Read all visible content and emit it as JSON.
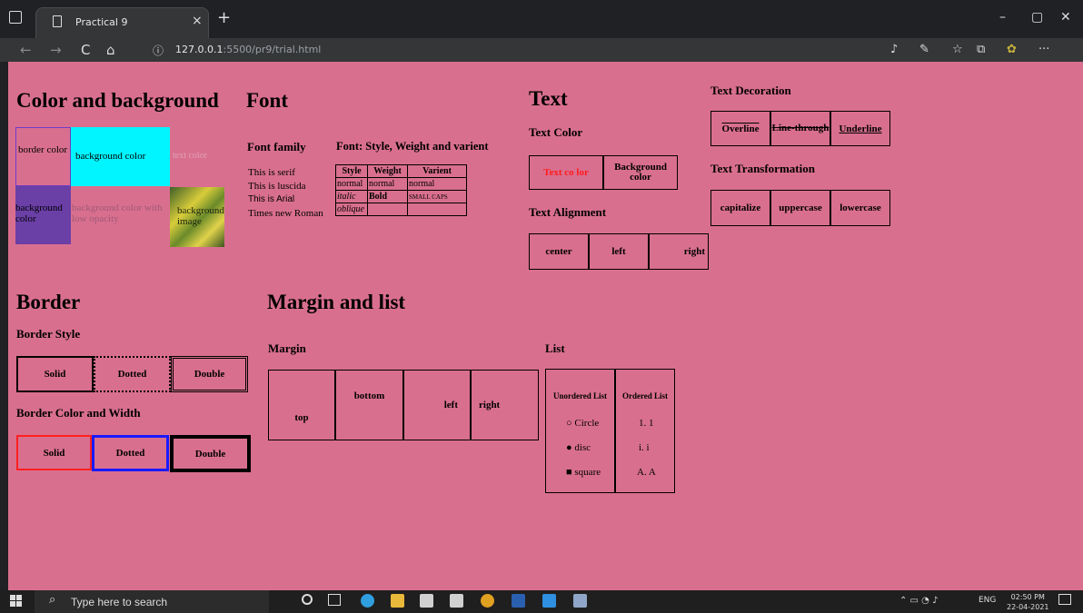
{
  "browser": {
    "tab_title": "Practical 9",
    "tab_close": "×",
    "new_tab": "+",
    "url_host": "127.0.0.1",
    "url_rest": ":5500/pr9/trial.html",
    "info": "ⓘ"
  },
  "window": {
    "minimize": "–",
    "maximize": "▢",
    "close": "✕"
  },
  "nav": {
    "back": "←",
    "forward": "→",
    "reload": "C",
    "home": "⌂"
  },
  "toolbar": {
    "more": "···"
  },
  "page": {
    "color_bg": {
      "title": "Color and background",
      "border_color": "border color",
      "background_color": "background color",
      "text_color": "text color",
      "bg_purple": "background color",
      "low_opacity": "background color with low opacity",
      "bg_image": "background image"
    },
    "font": {
      "title": "Font",
      "family_title": "Font family",
      "family_items": [
        "This is serif",
        "This is luscida",
        "This is Arial",
        "Times new Roman"
      ],
      "style_title": "Font: Style, Weight and varient",
      "table_headers": [
        "Style",
        "Weight",
        "Varient"
      ],
      "table_rows": [
        [
          "normal",
          "normal",
          "normal"
        ],
        [
          "italic",
          "Bold",
          "SMALL CAPS"
        ],
        [
          "oblique",
          "",
          ""
        ]
      ]
    },
    "text": {
      "title": "Text",
      "color_title": "Text Color",
      "text_color_box": "Text co lor",
      "bg_color_box": "Background color",
      "align_title": "Text Alignment",
      "align": [
        "center",
        "left",
        "right"
      ]
    },
    "deco": {
      "title": "Text Decoration",
      "items": [
        "Overline",
        "Line-through",
        "Underline"
      ],
      "transform_title": "Text Transformation",
      "transform": [
        "capitalize",
        "uppercase",
        "lowercase"
      ]
    },
    "border": {
      "title": "Border",
      "style_title": "Border Style",
      "styles": [
        "Solid",
        "Dotted",
        "Double"
      ],
      "cw_title": "Border Color and Width",
      "cw": [
        "Solid",
        "Dotted",
        "Double"
      ]
    },
    "margin": {
      "title": "Margin and list",
      "margin_title": "Margin",
      "boxes": [
        "top",
        "bottom",
        "left",
        "right"
      ]
    },
    "list": {
      "title": "List",
      "unordered_title": "Unordered List",
      "ordered_title": "Ordered List",
      "unordered": [
        "Circle",
        "disc",
        "square"
      ],
      "ordered": [
        "1. 1",
        "i. i",
        "A. A"
      ]
    }
  },
  "taskbar": {
    "search": "Type here to search",
    "lang": "ENG",
    "time": "02:50 PM",
    "date": "22-04-2021"
  }
}
